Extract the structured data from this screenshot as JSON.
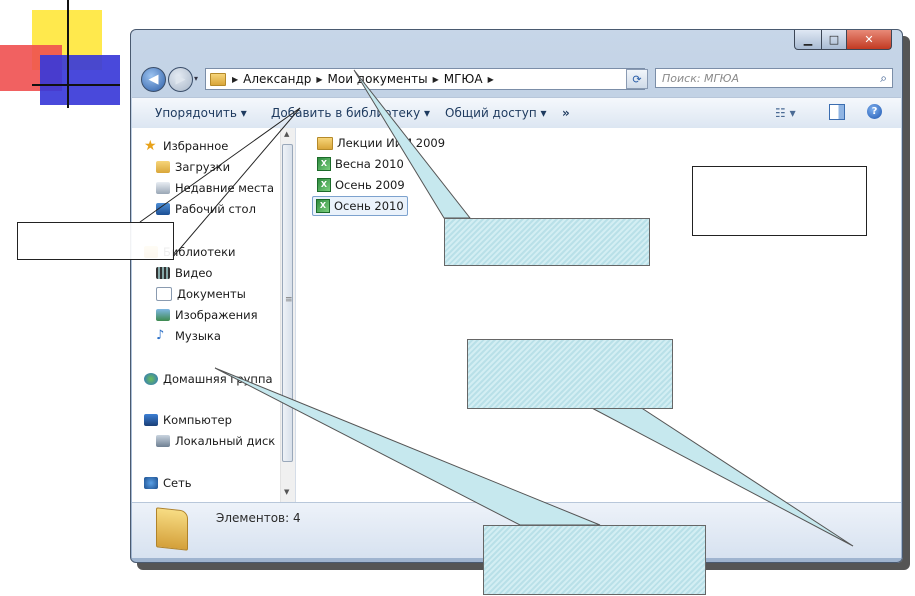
{
  "window": {
    "controls": {
      "minimize": "▁",
      "maximize": "□",
      "close": "✕"
    },
    "recent_pages": "▾"
  },
  "address_bar": {
    "breadcrumbs": [
      "Александр",
      "Мои документы",
      "МГЮА"
    ],
    "separator": "▶",
    "dropdown": "▾",
    "refresh": "⟳"
  },
  "search": {
    "placeholder": "Поиск: МГЮА",
    "icon": "⌕"
  },
  "toolbar": {
    "organize": "Упорядочить ▾",
    "add_to_library": "Добавить в библиотеку ▾",
    "share": "Общий доступ ▾",
    "more": "»",
    "views": "☷ ▾",
    "help": "?"
  },
  "nav_pane": {
    "favorites": "Избранное",
    "downloads": "Загрузки",
    "recent_places": "Недавние места",
    "desktop": "Рабочий стол",
    "libraries": "Библиотеки",
    "video": "Видео",
    "documents": "Документы",
    "pictures": "Изображения",
    "music": "Музыка",
    "homegroup": "Домашняя группа",
    "computer": "Компьютер",
    "local_disk": "Локальный диск",
    "network": "Сеть"
  },
  "files": [
    {
      "name": "Лекции ИиМ 2009",
      "type": "folder"
    },
    {
      "name": "Весна 2010",
      "type": "xls"
    },
    {
      "name": "Осень 2009",
      "type": "xls"
    },
    {
      "name": "Осень 2010",
      "type": "xls",
      "selected": true
    }
  ],
  "xls_glyph": "X",
  "status": {
    "count_text": "Элементов: 4"
  },
  "colors": {
    "callout_fill": "#c6e8ee",
    "window_frame": "#aec2da",
    "close_button": "#c23a22",
    "accent_yellow": "#ffe94d",
    "accent_red": "#f05050",
    "accent_blue": "#3a3ad8"
  }
}
